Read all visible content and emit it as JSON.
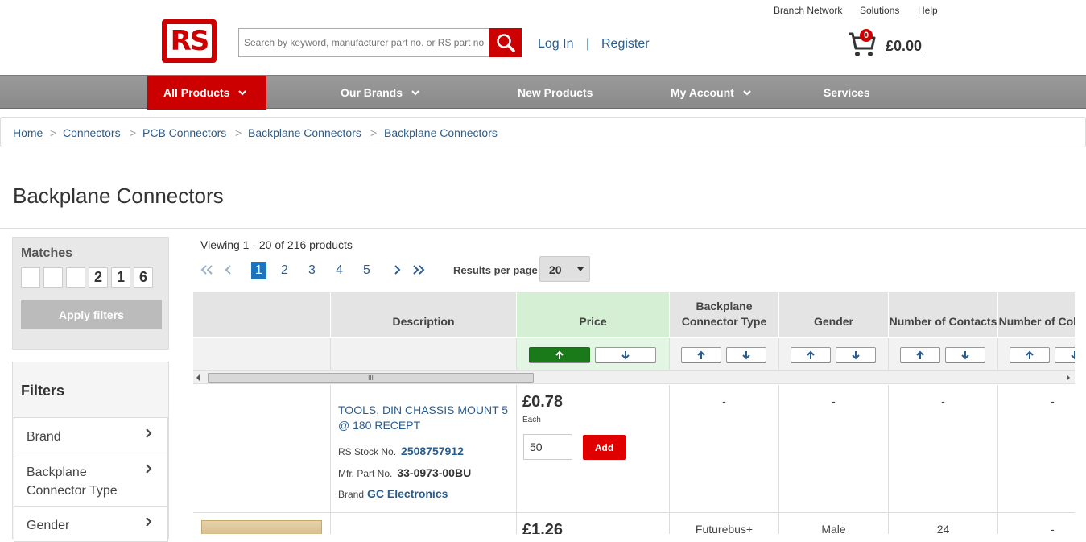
{
  "top_links": [
    "Branch Network",
    "Solutions",
    "Help"
  ],
  "logo_text": "RS",
  "search": {
    "placeholder": "Search by keyword, manufacturer part no. or RS part no"
  },
  "auth": {
    "login": "Log In",
    "separator": "|",
    "register": "Register"
  },
  "cart": {
    "count": "0",
    "total": "£0.00"
  },
  "nav": {
    "items": [
      {
        "label": "All Products",
        "active": true,
        "has_dropdown": true
      },
      {
        "label": "Our Brands",
        "has_dropdown": true
      },
      {
        "label": "New Products"
      },
      {
        "label": "My Account",
        "has_dropdown": true
      },
      {
        "label": "Services"
      }
    ]
  },
  "breadcrumb": [
    "Home",
    "Connectors",
    "PCB Connectors",
    "Backplane Connectors",
    "Backplane Connectors"
  ],
  "breadcrumb_sep": ">",
  "page_title": "Backplane Connectors",
  "matches": {
    "title": "Matches",
    "digits": [
      "",
      "",
      "",
      "2",
      "1",
      "6"
    ],
    "apply_label": "Apply filters"
  },
  "filters": {
    "title": "Filters",
    "items": [
      "Brand",
      "Backplane Connector Type",
      "Gender"
    ]
  },
  "results": {
    "viewing": "Viewing 1 - 20 of 216 products",
    "pages": [
      "1",
      "2",
      "3",
      "4",
      "5"
    ],
    "current_page": "1",
    "rpp_label": "Results per page",
    "rpp_value": "20"
  },
  "table": {
    "columns": [
      "",
      "Description",
      "Price",
      "Backplane Connector Type",
      "Gender",
      "Number of Contacts",
      "Number of Columns"
    ],
    "price_sort": "ascending",
    "scroll_grip": "III",
    "rows": [
      {
        "description": "TOOLS, DIN CHASSIS MOUNT 5 @ 180 RECEPT",
        "stock_label": "RS Stock No.",
        "stock_no": "2508757912",
        "mfr_label": "Mfr. Part No.",
        "mfr_no": "33-0973-00BU",
        "brand_label": "Brand",
        "brand": "GC Electronics",
        "price": "£0.78",
        "price_unit": "Each",
        "qty": "50",
        "add_label": "Add",
        "connector_type": "-",
        "gender": "-",
        "contacts": "-",
        "columns": "-"
      },
      {
        "price": "£1.26",
        "connector_type": "Futurebus+",
        "gender": "Male",
        "contacts": "24",
        "columns": "-"
      }
    ]
  },
  "colors": {
    "brand_red": "#cc0000",
    "link_blue": "#2a5d8f",
    "sort_active": "#1a7a1a"
  }
}
